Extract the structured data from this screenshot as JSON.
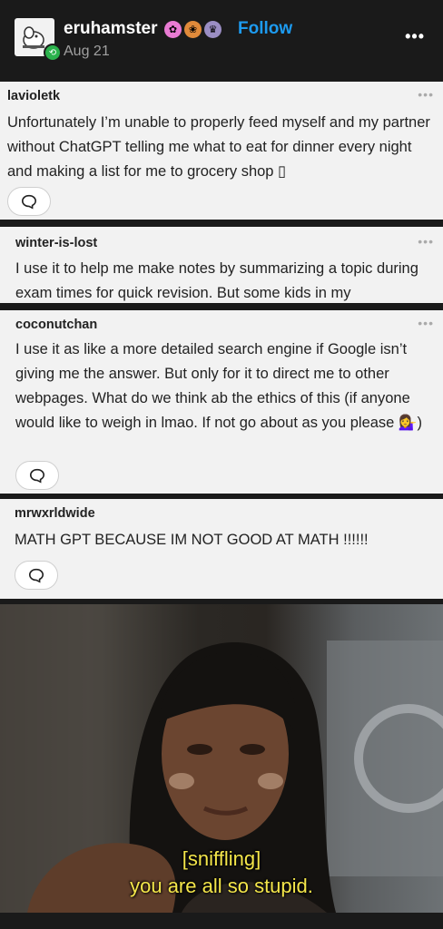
{
  "header": {
    "username": "eruhamster",
    "follow_label": "Follow",
    "date": "Aug 21"
  },
  "posts": [
    {
      "username": "lavioletk",
      "text": "Unfortunately I’m unable to properly feed myself and my partner without ChatGPT telling me what to eat for dinner every night and making a list for me to grocery shop ▯"
    },
    {
      "username": "winter-is-lost",
      "text": "I use it to help me make notes by summarizing a topic during exam times for quick revision. But some kids in my"
    },
    {
      "username": "coconutchan",
      "text": "I use it as like a more detailed search engine if Google isn’t giving me the answer.  But only for it to direct me to other webpages.  What do we think ab the ethics of this (if anyone would like to weigh in lmao.  If not go about as you please 💁‍♀️)"
    },
    {
      "username": "mrwxrldwide",
      "text": "MATH GPT BECAUSE IM NOT GOOD AT MATH !!!!!!"
    }
  ],
  "meme": {
    "caption_line1": "[sniffling]",
    "caption_line2": "you are all so stupid."
  },
  "icons": {
    "more": "more-icon",
    "reply": "reply-icon",
    "reblog": "reblog-icon"
  }
}
